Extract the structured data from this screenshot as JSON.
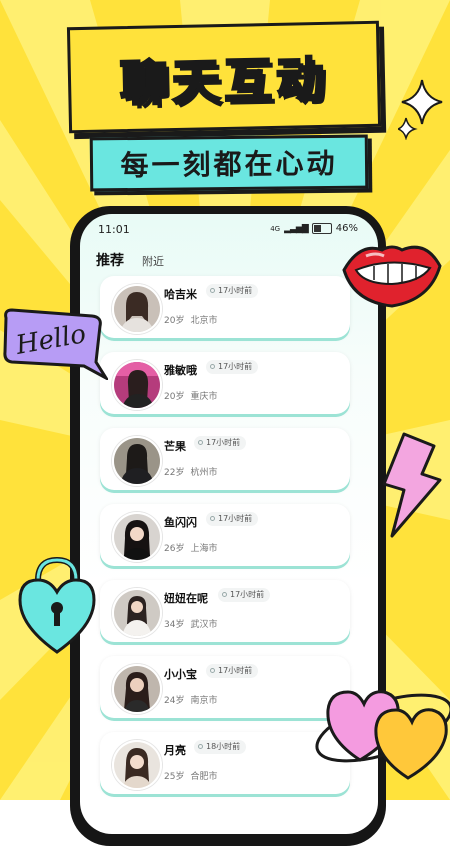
{
  "banner": {
    "title": "聊天互动",
    "subtitle": "每一刻都在心动"
  },
  "decorations": {
    "hello_text": "Hello"
  },
  "status_bar": {
    "time": "11:01",
    "network": "4G",
    "battery": "46%"
  },
  "tabs": [
    {
      "label": "推荐",
      "active": true
    },
    {
      "label": "附近",
      "active": false
    }
  ],
  "users": [
    {
      "name": "哈吉米",
      "time": "17小时前",
      "age": "20岁",
      "city": "北京市"
    },
    {
      "name": "雅敏哦",
      "time": "17小时前",
      "age": "20岁",
      "city": "重庆市"
    },
    {
      "name": "芒果",
      "time": "17小时前",
      "age": "22岁",
      "city": "杭州市"
    },
    {
      "name": "鱼闪闪",
      "time": "17小时前",
      "age": "26岁",
      "city": "上海市"
    },
    {
      "name": "妞妞在呢",
      "time": "17小时前",
      "age": "34岁",
      "city": "武汉市"
    },
    {
      "name": "小小宝",
      "time": "17小时前",
      "age": "24岁",
      "city": "南京市"
    },
    {
      "name": "月亮",
      "time": "18小时前",
      "age": "25岁",
      "city": "合肥市"
    }
  ],
  "colors": {
    "background": "#FFE23B",
    "accent": "#6AE6E0",
    "card_shadow": "#9CE3D5"
  }
}
